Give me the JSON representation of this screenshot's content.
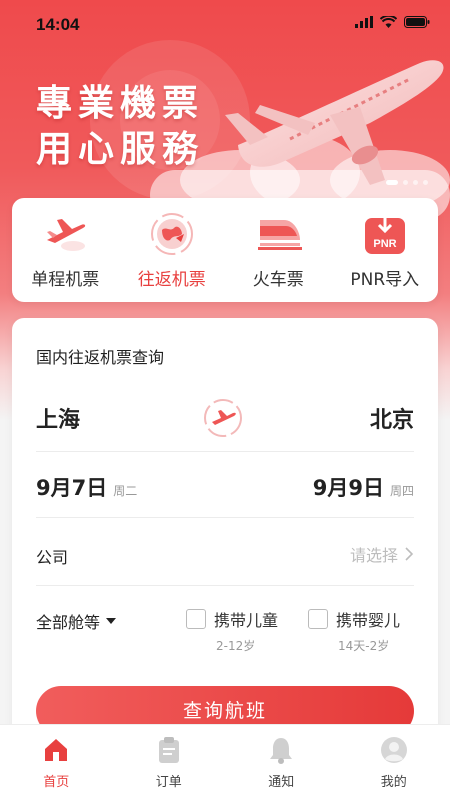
{
  "status_bar": {
    "time": "14:04"
  },
  "hero": {
    "slogan_line1": "專業機票",
    "slogan_line2": "用心服務"
  },
  "categories": [
    {
      "label": "单程机票",
      "icon": "one-way-flight-icon"
    },
    {
      "label": "往返机票",
      "icon": "round-trip-globe-icon",
      "active": true
    },
    {
      "label": "火车票",
      "icon": "train-icon"
    },
    {
      "label": "PNR导入",
      "icon": "pnr-import-icon",
      "badge": "PNR"
    }
  ],
  "query": {
    "title": "国内往返机票查询",
    "from_city": "上海",
    "to_city": "北京",
    "depart_date": "9月7日",
    "depart_weekday": "周二",
    "return_date": "9月9日",
    "return_weekday": "周四",
    "company_label": "公司",
    "company_placeholder": "请选择",
    "cabin_label": "全部舱等",
    "child_label": "携带儿童",
    "child_age": "2-12岁",
    "infant_label": "携带婴儿",
    "infant_age": "14天-2岁",
    "search_button": "查询航班"
  },
  "tabs": [
    {
      "label": "首页",
      "icon": "home-icon",
      "active": true
    },
    {
      "label": "订单",
      "icon": "order-clipboard-icon"
    },
    {
      "label": "通知",
      "icon": "bell-icon"
    },
    {
      "label": "我的",
      "icon": "profile-icon"
    }
  ],
  "colors": {
    "accent": "#e8403f",
    "hero": "#ef4a4c"
  }
}
